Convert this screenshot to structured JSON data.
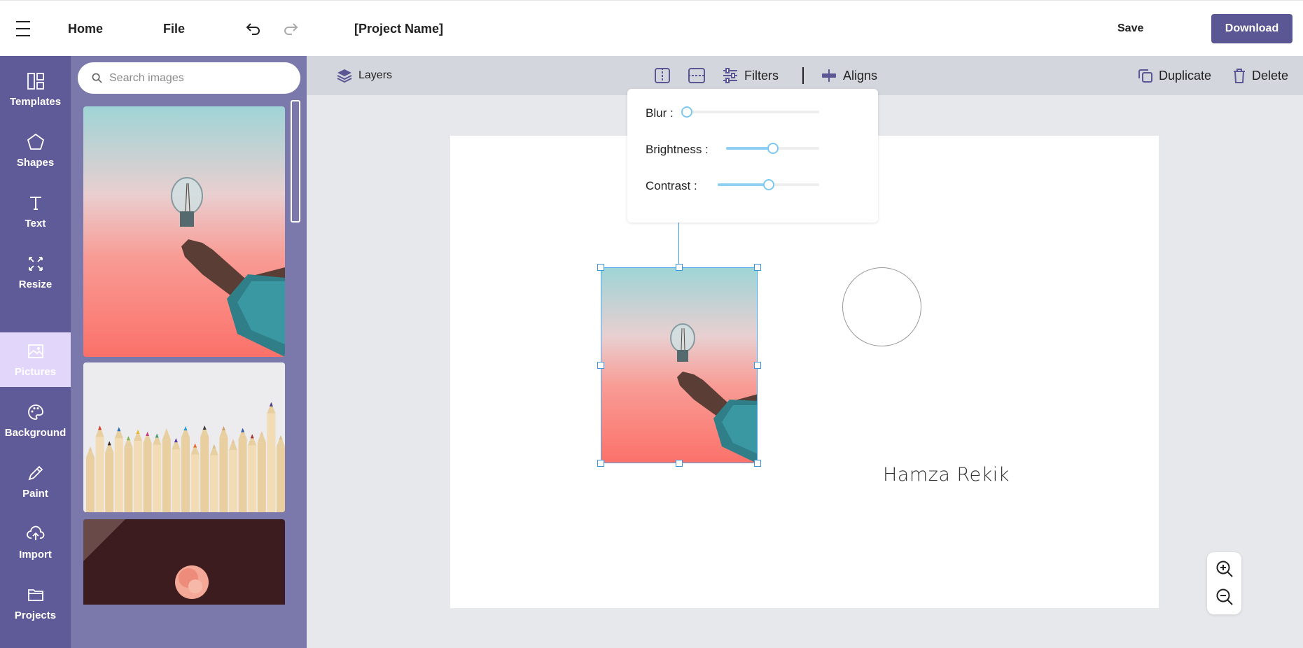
{
  "topbar": {
    "home": "Home",
    "file": "File",
    "project_name": "[Project Name]",
    "save": "Save",
    "download": "Download",
    "undo_icon": "undo-icon",
    "redo_icon": "redo-icon"
  },
  "rail": {
    "items": [
      {
        "label": "Templates",
        "icon": "templates-icon"
      },
      {
        "label": "Shapes",
        "icon": "pentagon-icon"
      },
      {
        "label": "Text",
        "icon": "text-icon"
      },
      {
        "label": "Resize",
        "icon": "resize-icon"
      },
      {
        "label": "Pictures",
        "icon": "image-icon",
        "active": true
      },
      {
        "label": "Background",
        "icon": "palette-icon"
      },
      {
        "label": "Paint",
        "icon": "pencil-icon"
      },
      {
        "label": "Import",
        "icon": "upload-icon"
      },
      {
        "label": "Projects",
        "icon": "folder-icon"
      }
    ],
    "active_bg": "#e3d6fb",
    "bg": "#5f5a98"
  },
  "panel": {
    "search_placeholder": "Search images",
    "images": [
      "lightbulb-hand-photo",
      "colored-pencils-photo",
      "pink-rose-photo"
    ]
  },
  "toolbar": {
    "layers": "Layers",
    "filters": "Filters",
    "aligns": "Aligns",
    "duplicate": "Duplicate",
    "delete": "Delete"
  },
  "filters": {
    "blur_label": "Blur :",
    "brightness_label": "Brightness :",
    "contrast_label": "Contrast :",
    "blur_value": 0,
    "brightness_value": 0.5,
    "contrast_value": 0.5
  },
  "canvas": {
    "text": "Hamza Rekik"
  },
  "colors": {
    "accent": "#5b5794",
    "selection": "#3b98dd",
    "slider": "#8ecff3"
  }
}
